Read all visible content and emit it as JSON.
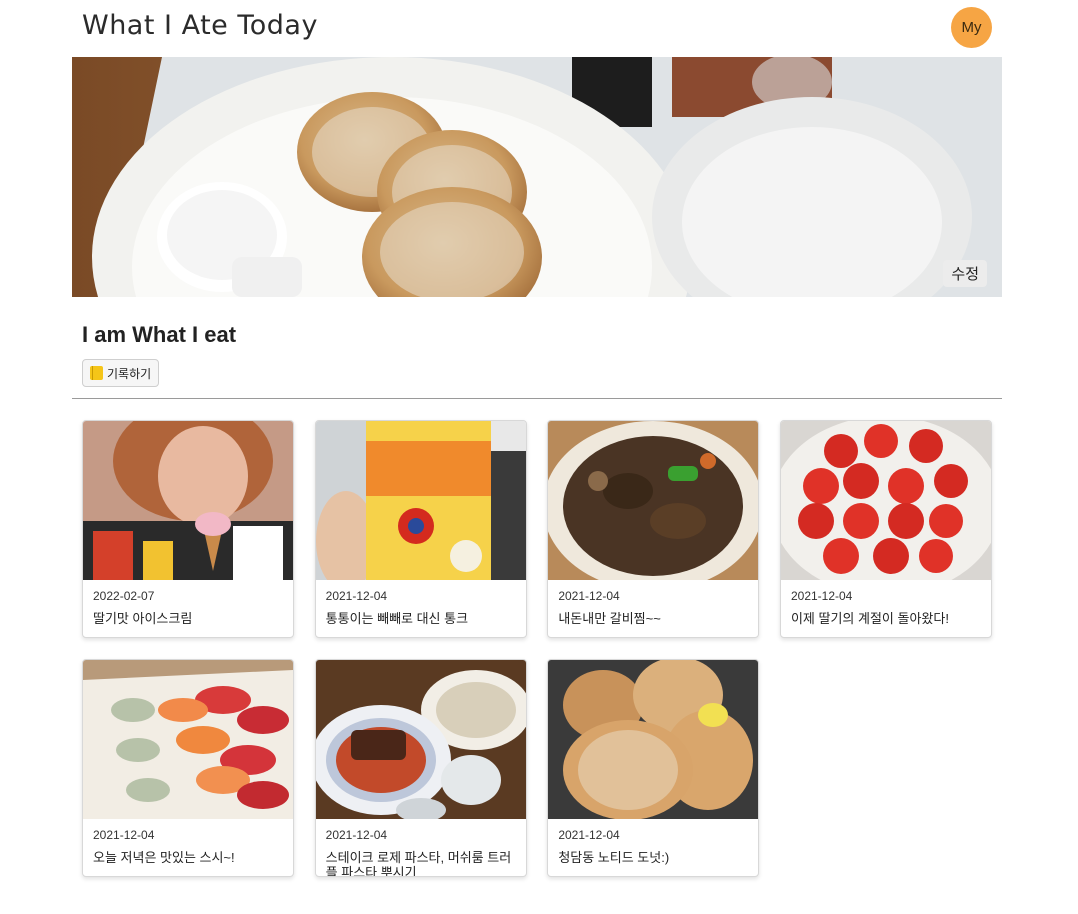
{
  "header": {
    "title": "What I Ate Today",
    "avatar_label": "My"
  },
  "hero": {
    "edit_label": "수정"
  },
  "profile": {
    "title": "I am What I eat",
    "record_label": "기록하기",
    "record_icon": "notebook-icon"
  },
  "posts": [
    {
      "date": "2022-02-07",
      "text": "딸기맛 아이스크림"
    },
    {
      "date": "2021-12-04",
      "text": "통통이는 빼빼로 대신 통크"
    },
    {
      "date": "2021-12-04",
      "text": "내돈내만 갈비찜~~"
    },
    {
      "date": "2021-12-04",
      "text": "이제 딸기의 계절이 돌아왔다!"
    },
    {
      "date": "2021-12-04",
      "text": "오늘 저녁은 맛있는 스시~!"
    },
    {
      "date": "2021-12-04",
      "text": "스테이크 로제 파스타, 머쉬룸 트러플 파스타 뿌시기"
    },
    {
      "date": "2021-12-04",
      "text": "청담동 노티드 도넛:)"
    }
  ],
  "colors": {
    "avatar": "#f6a544",
    "divider": "#9a9a9a"
  }
}
